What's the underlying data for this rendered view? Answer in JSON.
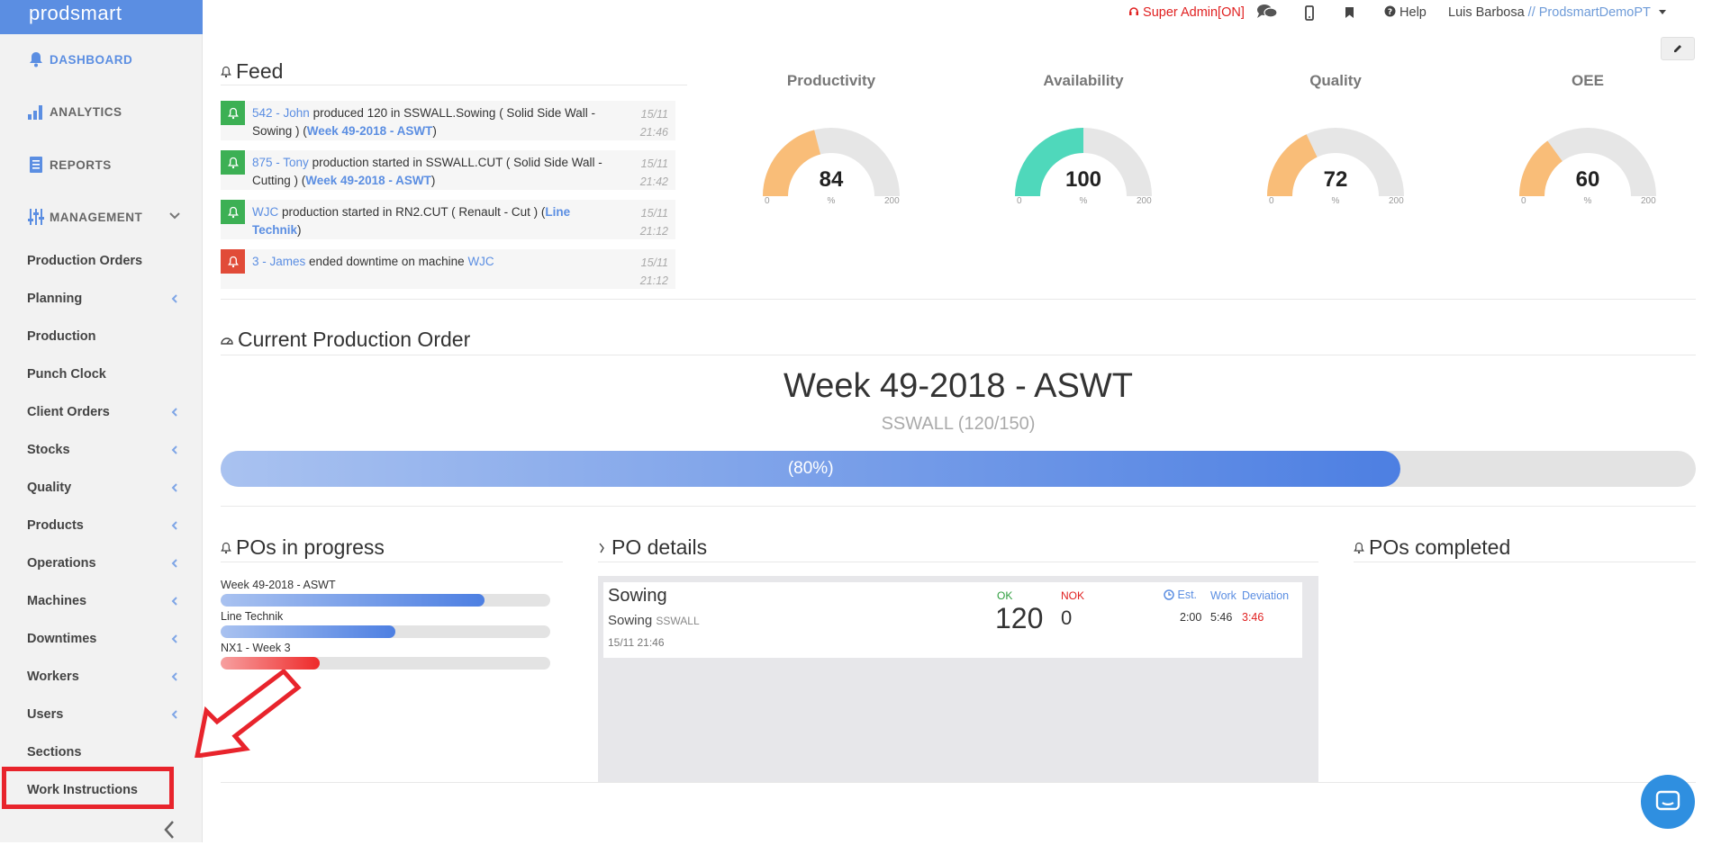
{
  "sidebar": {
    "logo": "prodsmart",
    "main_items": [
      {
        "label": "DASHBOARD",
        "icon": "bell-icon"
      },
      {
        "label": "ANALYTICS",
        "icon": "bar-chart-icon"
      },
      {
        "label": "REPORTS",
        "icon": "document-icon"
      },
      {
        "label": "MANAGEMENT",
        "icon": "sliders-icon"
      }
    ],
    "sub_items": [
      {
        "label": "Production Orders"
      },
      {
        "label": "Planning"
      },
      {
        "label": "Production"
      },
      {
        "label": "Punch Clock"
      },
      {
        "label": "Client Orders"
      },
      {
        "label": "Stocks"
      },
      {
        "label": "Quality"
      },
      {
        "label": "Products"
      },
      {
        "label": "Operations"
      },
      {
        "label": "Machines"
      },
      {
        "label": "Downtimes"
      },
      {
        "label": "Workers"
      },
      {
        "label": "Users"
      },
      {
        "label": "Sections"
      },
      {
        "label": "Work Instructions"
      }
    ]
  },
  "topbar": {
    "super_admin": "Super Admin[ON]",
    "help": "Help",
    "user": "Luis Barbosa",
    "separator": "//",
    "company": "ProdsmartDemoPT"
  },
  "feed": {
    "title": "Feed",
    "items": [
      {
        "status": "green",
        "who": "542 - John",
        "text": "produced 120 in SSWALL.Sowing ( Solid Side Wall - Sowing ) (",
        "link": "Week 49-2018 - ASWT",
        "tail": ")",
        "date": "15/11",
        "time": "21:46"
      },
      {
        "status": "green",
        "who": "875 - Tony",
        "text": "production started in SSWALL.CUT ( Solid Side Wall - Cutting ) (",
        "link": "Week 49-2018 - ASWT",
        "tail": ")",
        "date": "15/11",
        "time": "21:42"
      },
      {
        "status": "green",
        "who": "WJC",
        "text": "production started in RN2.CUT ( Renault - Cut ) (",
        "link": "Line Technik",
        "tail": ")",
        "date": "15/11",
        "time": "21:12"
      },
      {
        "status": "red",
        "who": "3 - James",
        "text": "ended downtime on machine",
        "link": "WJC",
        "tail": "",
        "date": "15/11",
        "time": "21:12"
      }
    ]
  },
  "gauges": [
    {
      "title": "Productivity",
      "value": 84,
      "display": "84",
      "min": "0",
      "max": "200",
      "unit": "%",
      "color": "#f9bd78"
    },
    {
      "title": "Availability",
      "value": 100,
      "display": "100",
      "min": "0",
      "max": "200",
      "unit": "%",
      "color": "#4fd8bb"
    },
    {
      "title": "Quality",
      "value": 72,
      "display": "72",
      "min": "0",
      "max": "200",
      "unit": "%",
      "color": "#f9bd78"
    },
    {
      "title": "OEE",
      "value": 60,
      "display": "60",
      "min": "0",
      "max": "200",
      "unit": "%",
      "color": "#f9bd78"
    }
  ],
  "current_po": {
    "section_title": "Current Production Order",
    "name": "Week 49-2018 - ASWT",
    "subtitle": "SSWALL (120/150)",
    "progress": 0.8,
    "progress_label": "(80%)"
  },
  "pos_in_progress": {
    "title": "POs in progress",
    "items": [
      {
        "label": "Week 49-2018 - ASWT",
        "progress": 0.8,
        "color": "blue"
      },
      {
        "label": "Line Technik",
        "progress": 0.53,
        "color": "blue"
      },
      {
        "label": "NX1 - Week 3",
        "progress": 0.3,
        "color": "red"
      }
    ]
  },
  "po_details": {
    "title": "PO details",
    "operation": "Sowing",
    "operation_sub": "Sowing",
    "product": "SSWALL",
    "timestamp": "15/11 21:46",
    "ok_label": "OK",
    "ok_value": "120",
    "nok_label": "NOK",
    "nok_value": "0",
    "est_label": "Est.",
    "work_label": "Work",
    "deviation_label": "Deviation",
    "est_value": "2:00",
    "work_value": "5:46",
    "deviation_value": "3:46"
  },
  "pos_completed": {
    "title": "POs completed"
  }
}
